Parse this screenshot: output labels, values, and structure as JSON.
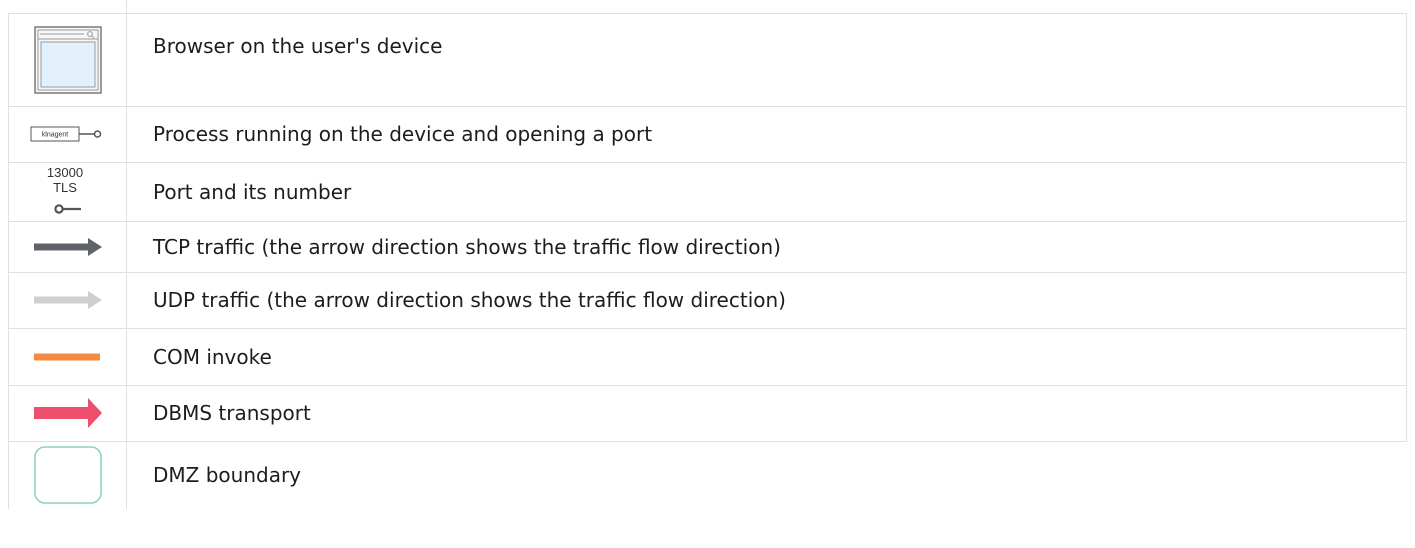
{
  "legend": {
    "rows": [
      {
        "icon": "browser-window-icon",
        "label": "Browser on the user's device"
      },
      {
        "icon": "process-port-icon",
        "label": "Process running on the device and opening a port",
        "icon_text": "klnagent"
      },
      {
        "icon": "port-icon",
        "label": "Port and its number",
        "icon_text_number": "13000",
        "icon_text_protocol": "TLS"
      },
      {
        "icon": "tcp-arrow-icon",
        "label": "TCP traffic (the arrow direction shows the traffic flow direction)"
      },
      {
        "icon": "udp-arrow-icon",
        "label": "UDP traffic (the arrow direction shows the traffic flow direction)"
      },
      {
        "icon": "com-line-icon",
        "label": "COM invoke"
      },
      {
        "icon": "dbms-arrow-icon",
        "label": "DBMS transport"
      },
      {
        "icon": "dmz-box-icon",
        "label": "DMZ boundary"
      }
    ]
  },
  "colors": {
    "tcp": "#5f6368",
    "udp": "#cfcfcf",
    "com": "#f58b3f",
    "dbms": "#ec4e6c",
    "dmz_border": "#8fcfb8",
    "browser_fill": "#e3f1fd",
    "browser_border": "#7a7a7a"
  }
}
